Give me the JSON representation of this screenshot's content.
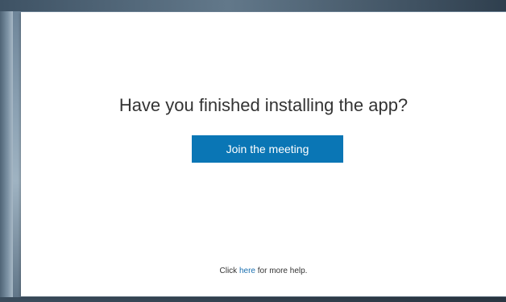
{
  "dialog": {
    "heading": "Have you finished installing the app?",
    "join_button_label": "Join the meeting",
    "help": {
      "prefix": "Click ",
      "link_text": "here",
      "suffix": " for more help."
    }
  },
  "colors": {
    "button_background": "#0a76b5",
    "link": "#1a6fb0",
    "text": "#333333"
  }
}
